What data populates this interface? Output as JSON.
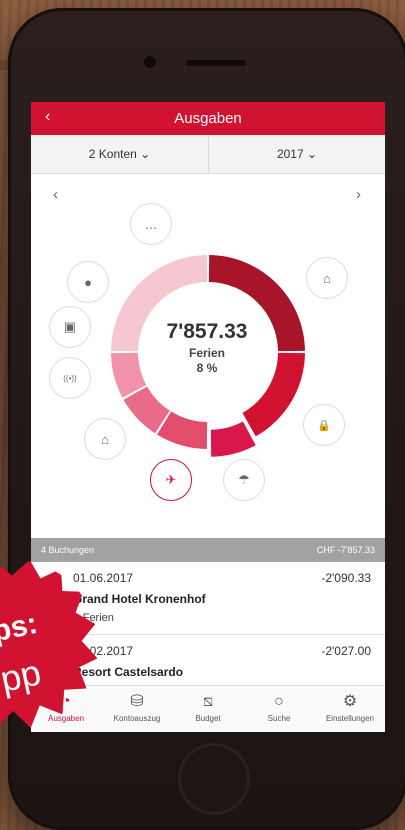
{
  "header": {
    "back_icon": "‹",
    "title": "Ausgaben"
  },
  "filters": {
    "accounts": "2 Konten",
    "year": "2017",
    "chevron": "⌄"
  },
  "nav": {
    "prev": "‹",
    "next": "›"
  },
  "chart_data": {
    "type": "pie",
    "center_amount": "7'857.33",
    "center_category": "Ferien",
    "center_percent": "8 %",
    "segments": [
      {
        "name": "home",
        "value": 0.25,
        "color": "#a8152b"
      },
      {
        "name": "lock",
        "value": 0.17,
        "color": "#d11231"
      },
      {
        "name": "vacation",
        "value": 0.08,
        "color": "#d8174a"
      },
      {
        "name": "bank",
        "value": 0.09,
        "color": "#e24d6e"
      },
      {
        "name": "broadcast",
        "value": 0.08,
        "color": "#ea6b88"
      },
      {
        "name": "video",
        "value": 0.08,
        "color": "#f093a8"
      },
      {
        "name": "food",
        "value": 0.25,
        "color": "#f6c6d1"
      }
    ]
  },
  "category_icons": {
    "more": "…",
    "food": "●",
    "video": "▣",
    "broadcast": "((•))",
    "bank": "⌂",
    "vacation": "✈",
    "umbrella": "☂",
    "lock": "🔒",
    "home": "⌂"
  },
  "list": {
    "summary_count": "4 Buchungen",
    "summary_total": "CHF -7'857.33",
    "items": [
      {
        "date": "01.06.2017",
        "amount": "-2'090.33",
        "name": "Grand Hotel Kronenhof",
        "tag": "Ferien"
      },
      {
        "date": "20.02.2017",
        "amount": "-2'027.00",
        "name": "Resort Castelsardo"
      }
    ]
  },
  "tabs": [
    {
      "label": "Ausgaben"
    },
    {
      "label": "Kontoauszug"
    },
    {
      "label": "Budget"
    },
    {
      "label": "Suche"
    },
    {
      "label": "Einstellungen"
    }
  ],
  "promo": {
    "line1": "ps:",
    "line2": "pp"
  }
}
